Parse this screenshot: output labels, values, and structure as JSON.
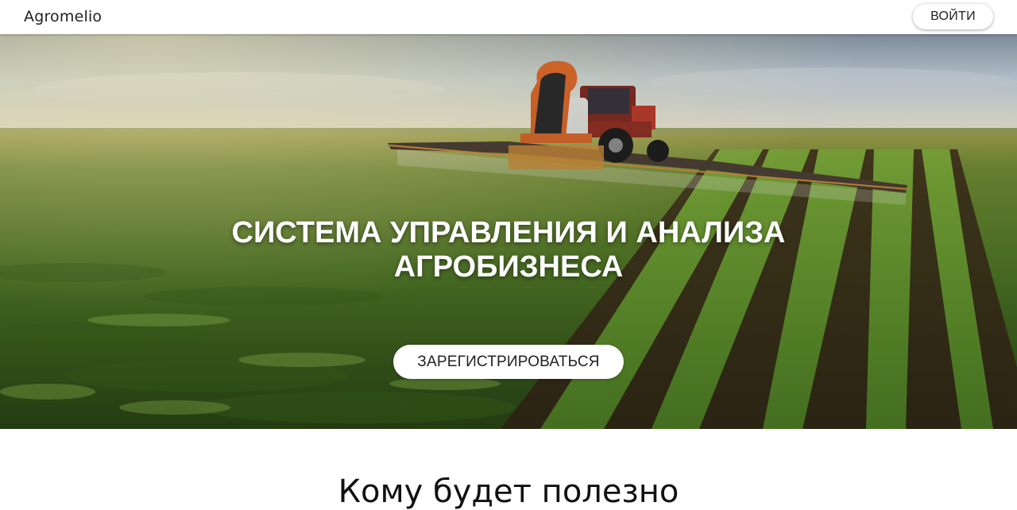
{
  "header": {
    "logo": "Agromelio",
    "login_label": "ВОЙТИ"
  },
  "hero": {
    "title_line1": "СИСТЕМА УПРАВЛЕНИЯ И АНАЛИЗА",
    "title_line2": "АГРОБИЗНЕСА",
    "register_label": "ЗАРЕГИСТРИРОВАТЬСЯ"
  },
  "section": {
    "title": "Кому будет полезно"
  },
  "colors": {
    "sky": "#8fa4b8",
    "field": "#4e7a2a",
    "soil": "#3a2a1a",
    "tractor": "#b23a2a",
    "hose": "#d0652a"
  }
}
